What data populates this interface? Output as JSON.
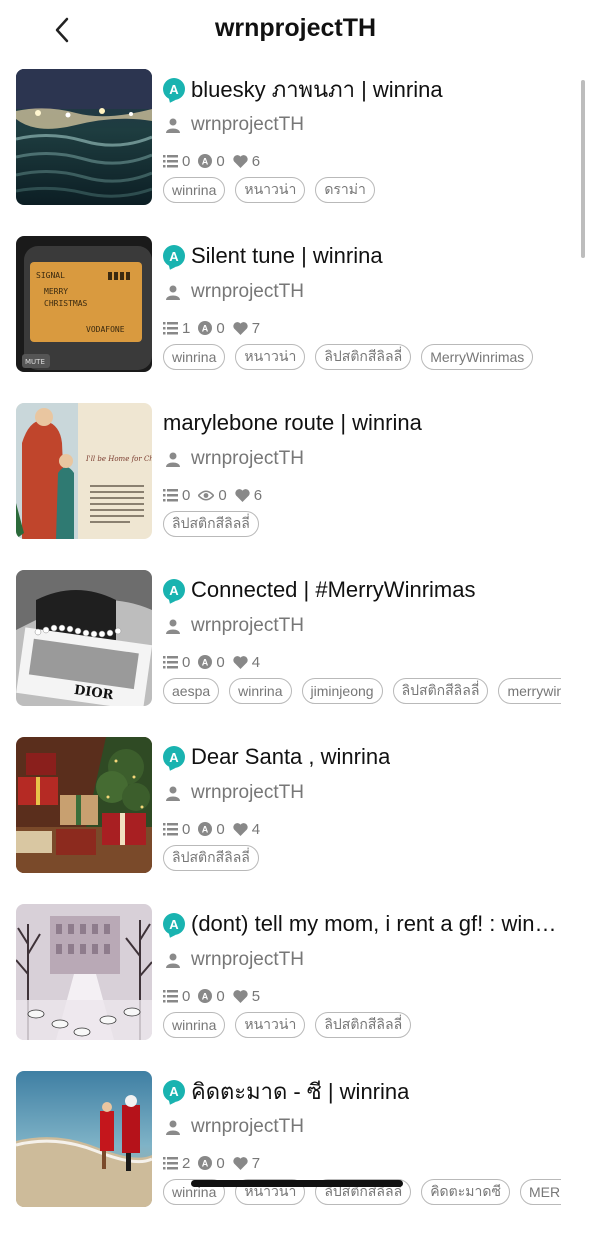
{
  "header": {
    "title": "wrnprojectTH",
    "back_icon": "chevron-left-icon"
  },
  "colors": {
    "badge": "#19b3b0",
    "muted_text": "#777777",
    "tag_border": "#b9b9b9"
  },
  "stories": [
    {
      "title": "bluesky ภาพนภา | winrina",
      "has_badge": true,
      "author": "wrnprojectTH",
      "chapters": "0",
      "second_stat": "0",
      "second_stat_icon": "comment-icon",
      "likes": "6",
      "tags": [
        "winrina",
        "หนาวน่า",
        "ดราม่า"
      ]
    },
    {
      "title": "Silent tune | winrina",
      "has_badge": true,
      "author": "wrnprojectTH",
      "chapters": "1",
      "second_stat": "0",
      "second_stat_icon": "comment-icon",
      "likes": "7",
      "tags": [
        "winrina",
        "หนาวน่า",
        "ลิปสติกสีลิลลี่",
        "MerryWinrimas"
      ]
    },
    {
      "title": "marylebone route | winrina",
      "has_badge": false,
      "author": "wrnprojectTH",
      "chapters": "0",
      "second_stat": "0",
      "second_stat_icon": "eye-icon",
      "likes": "6",
      "tags": [
        "ลิปสติกสีลิลลี่"
      ]
    },
    {
      "title": "Connected | #MerryWinrimas",
      "has_badge": true,
      "author": "wrnprojectTH",
      "chapters": "0",
      "second_stat": "0",
      "second_stat_icon": "comment-icon",
      "likes": "4",
      "tags": [
        "aespa",
        "winrina",
        "jiminjeong",
        "ลิปสติกสีลิลลี่",
        "merrywinrimas"
      ]
    },
    {
      "title": "Dear Santa , winrina",
      "has_badge": true,
      "author": "wrnprojectTH",
      "chapters": "0",
      "second_stat": "0",
      "second_stat_icon": "comment-icon",
      "likes": "4",
      "tags": [
        "ลิปสติกสีลิลลี่"
      ]
    },
    {
      "title": "(dont) tell my mom, i rent a gf! : winrina",
      "has_badge": true,
      "author": "wrnprojectTH",
      "chapters": "0",
      "second_stat": "0",
      "second_stat_icon": "comment-icon",
      "likes": "5",
      "tags": [
        "winrina",
        "หนาวน่า",
        "ลิปสติกสีลิลลี่"
      ]
    },
    {
      "title": "คิดตะมาด - ซี | winrina",
      "has_badge": true,
      "author": "wrnprojectTH",
      "chapters": "2",
      "second_stat": "0",
      "second_stat_icon": "comment-icon",
      "likes": "7",
      "tags": [
        "winrina",
        "หนาวน่า",
        "ลิปสติกสีลิลลี่",
        "คิดตะมาดซี",
        "MERRYWINRIMAS"
      ]
    }
  ],
  "thumbnails": {
    "t0": {
      "label": ""
    },
    "t1": {
      "line1": "SIGNAL",
      "line2": "MERRY",
      "line3": "CHRISTMAS",
      "line4": "VODAFONE",
      "key": "MUTE"
    },
    "t2": {
      "script": "I'll be Home for Christmas!"
    },
    "t3": {
      "brand": "DIOR"
    }
  }
}
